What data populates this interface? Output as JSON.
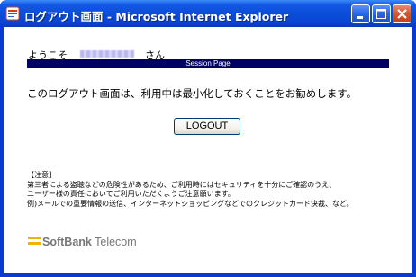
{
  "window": {
    "title": "ログアウト画面 - Microsoft Internet Explorer",
    "icon": "ie-icon",
    "buttons": [
      "minimize-icon",
      "maximize-icon",
      "close-icon"
    ]
  },
  "page": {
    "welcome_prefix": "ようこそ",
    "welcome_suffix": "さん",
    "session_bar": "Session Page",
    "recommend_text": "このログアウト画面は、利用中は最小化しておくことをお勧めします。",
    "logout_label": "LOGOUT",
    "notice": {
      "heading": "【注意】",
      "line1": "第三者による盗聴などの危険性があるため、ご利用時にはセキュリティを十分にご確認のうえ、",
      "line2": "ユーザー様の責任においてご利用いただくようご注意願います。",
      "line3": "例)メールでの重要情報の送信、インターネットショッピングなどでのクレジットカード決裁、など。"
    },
    "logo": {
      "part1": "SoftBank",
      "part2": "Telecom"
    }
  },
  "colors": {
    "titlebar": "#0a4bd8",
    "session_bar": "#000066",
    "logo_accent": "#f0b400",
    "logo_text": "#777777"
  }
}
